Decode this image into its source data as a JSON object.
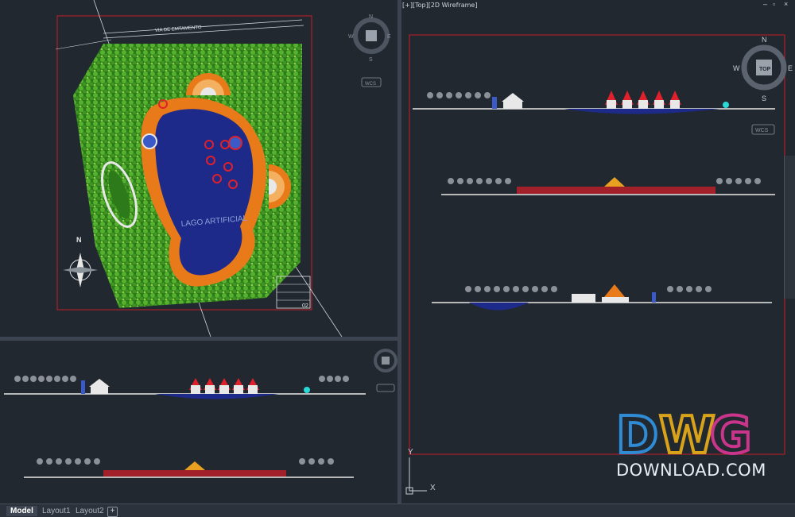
{
  "viewport_top_right": {
    "label": "[+][Top][2D Wireframe]"
  },
  "window_controls": [
    "–",
    "▫",
    "×"
  ],
  "plan": {
    "road_label": "VIA DE EMTAMENTO",
    "lake_label": "LAGO ARTIFICIAL",
    "north_label": "N",
    "title_block_number": "02"
  },
  "viewcube": {
    "face": "TOP",
    "north": "N",
    "south": "S",
    "east": "E",
    "west": "W",
    "ucs": "WCS"
  },
  "ucs_icon": {
    "x": "X",
    "y": "Y"
  },
  "tabs": [
    {
      "label": "Model",
      "active": true
    },
    {
      "label": "Layout1",
      "active": false
    },
    {
      "label": "Layout2",
      "active": false
    }
  ],
  "tab_add": "+",
  "watermark": {
    "logo_letters": [
      "D",
      "W",
      "G"
    ],
    "text": "DOWNLOAD.COM"
  },
  "colors": {
    "background": "#212830",
    "vegetation": "#2f8a1f",
    "lake": "#1d2a8a",
    "path": "#e87a1a",
    "viewport_border": "#c81e28",
    "dwg_d": "#2f8bd4",
    "dwg_w": "#d8a21a",
    "dwg_g": "#c9358a"
  }
}
